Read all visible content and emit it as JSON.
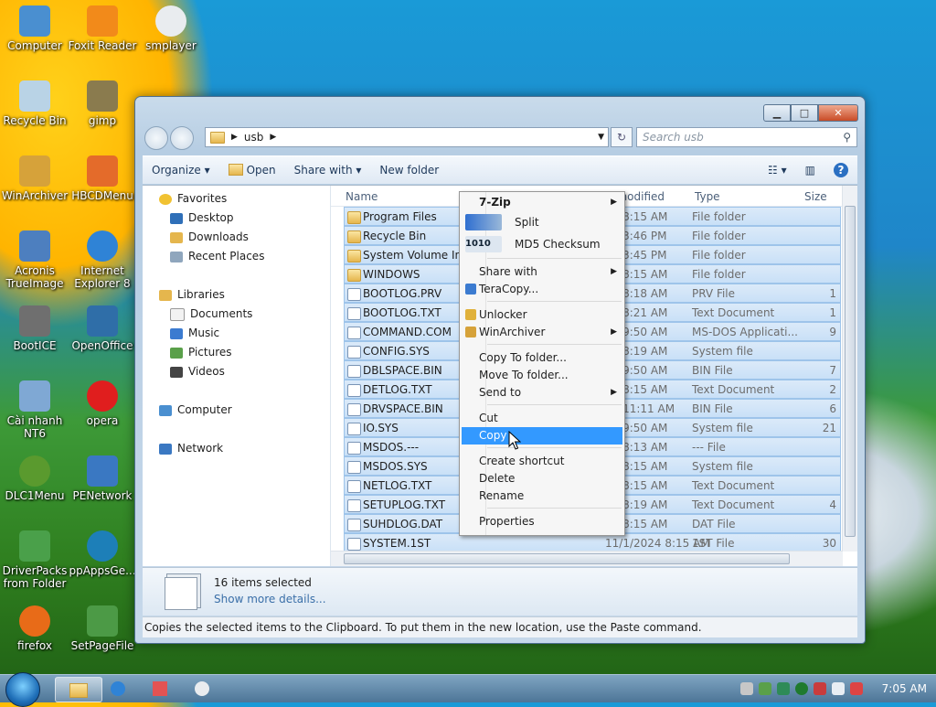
{
  "desktop": {
    "icons": [
      {
        "label": "Computer",
        "icon": "computer-icon",
        "color": "#4a8fd0"
      },
      {
        "label": "Foxit Reader",
        "icon": "pdf-icon",
        "color": "#f28a1a"
      },
      {
        "label": "smplayer",
        "icon": "penguin-icon",
        "color": "#e9ecef"
      },
      {
        "label": "Recycle Bin",
        "icon": "recycle-bin-icon",
        "color": "#b9d3e6"
      },
      {
        "label": "gimp",
        "icon": "gimp-icon",
        "color": "#8a7b4e"
      },
      {
        "label": "WinArchiver",
        "icon": "archive-icon",
        "color": "#d6a23a"
      },
      {
        "label": "HBCDMenu",
        "icon": "tools-icon",
        "color": "#e46b2a"
      },
      {
        "label": "Acronis TrueImage",
        "icon": "disk-icon",
        "color": "#4d7fbf"
      },
      {
        "label": "Internet Explorer 8",
        "icon": "ie-icon",
        "color": "#2f83d6"
      },
      {
        "label": "BootICE",
        "icon": "boot-icon",
        "color": "#6f6f6f"
      },
      {
        "label": "OpenOffice",
        "icon": "openoffice-icon",
        "color": "#2f6ea8"
      },
      {
        "label": "Cài nhanh NT6",
        "icon": "install-icon",
        "color": "#7fa8d4"
      },
      {
        "label": "opera",
        "icon": "opera-icon",
        "color": "#e01e1e"
      },
      {
        "label": "DLC1Menu",
        "icon": "dlc-icon",
        "color": "#5a9a2e"
      },
      {
        "label": "PENetwork",
        "icon": "network-icon",
        "color": "#3a78c2"
      },
      {
        "label": "DriverPacks from Folder",
        "icon": "driver-icon",
        "color": "#4aa04a"
      },
      {
        "label": "ppAppsGe...",
        "icon": "apps-icon",
        "color": "#1d7fb8"
      },
      {
        "label": "firefox",
        "icon": "firefox-icon",
        "color": "#e86b18"
      },
      {
        "label": "SetPageFile",
        "icon": "pagefile-icon",
        "color": "#4c9a46"
      }
    ]
  },
  "window": {
    "address": {
      "root": "usb"
    },
    "search_placeholder": "Search usb",
    "toolbar": {
      "organize": "Organize",
      "open": "Open",
      "share_with": "Share with",
      "new_folder": "New folder"
    },
    "nav": {
      "favorites": "Favorites",
      "desktop": "Desktop",
      "downloads": "Downloads",
      "recent": "Recent Places",
      "libraries": "Libraries",
      "documents": "Documents",
      "music": "Music",
      "pictures": "Pictures",
      "videos": "Videos",
      "computer": "Computer",
      "network": "Network"
    },
    "columns": {
      "name": "Name",
      "date": "Date modified",
      "type": "Type",
      "size": "Size"
    },
    "files": [
      {
        "name": "Program Files",
        "date": "24 8:15 AM",
        "type": "File folder",
        "size": "",
        "folder": true
      },
      {
        "name": "Recycle Bin",
        "date": "24 3:46 PM",
        "type": "File folder",
        "size": "",
        "folder": true
      },
      {
        "name": "System Volume Inf",
        "date": "24 3:45 PM",
        "type": "File folder",
        "size": "",
        "folder": true
      },
      {
        "name": "WINDOWS",
        "date": "24 8:15 AM",
        "type": "File folder",
        "size": "",
        "folder": true
      },
      {
        "name": "BOOTLOG.PRV",
        "date": "24 8:18 AM",
        "type": "PRV File",
        "size": "1",
        "folder": false
      },
      {
        "name": "BOOTLOG.TXT",
        "date": "24 8:21 AM",
        "type": "Text Document",
        "size": "1",
        "folder": false
      },
      {
        "name": "COMMAND.COM",
        "date": "05 9:50 AM",
        "type": "MS-DOS Applicati...",
        "size": "9",
        "folder": false
      },
      {
        "name": "CONFIG.SYS",
        "date": "24 8:19 AM",
        "type": "System file",
        "size": "",
        "folder": false
      },
      {
        "name": "DBLSPACE.BIN",
        "date": "05 9:50 AM",
        "type": "BIN File",
        "size": "7",
        "folder": false
      },
      {
        "name": "DETLOG.TXT",
        "date": "24 8:15 AM",
        "type": "Text Document",
        "size": "2",
        "folder": false
      },
      {
        "name": "DRVSPACE.BIN",
        "date": "06 11:11 AM",
        "type": "BIN File",
        "size": "6",
        "folder": false
      },
      {
        "name": "IO.SYS",
        "date": "05 9:50 AM",
        "type": "System file",
        "size": "21",
        "folder": false
      },
      {
        "name": "MSDOS.---",
        "date": "24 8:13 AM",
        "type": "--- File",
        "size": "",
        "folder": false
      },
      {
        "name": "MSDOS.SYS",
        "date": "24 8:15 AM",
        "type": "System file",
        "size": "",
        "folder": false
      },
      {
        "name": "NETLOG.TXT",
        "date": "24 8:15 AM",
        "type": "Text Document",
        "size": "",
        "folder": false
      },
      {
        "name": "SETUPLOG.TXT",
        "date": "24 8:19 AM",
        "type": "Text Document",
        "size": "4",
        "folder": false
      },
      {
        "name": "SUHDLOG.DAT",
        "date": "24 8:15 AM",
        "type": "DAT File",
        "size": "",
        "folder": false
      },
      {
        "name": "SYSTEM.1ST",
        "date": "11/1/2024 8:15 AM",
        "type": "1ST File",
        "size": "30",
        "folder": false
      }
    ],
    "details": {
      "count": "16 items selected",
      "more": "Show more details..."
    },
    "status": "Copies the selected items to the Clipboard. To put them in the new location, use the Paste command."
  },
  "context_menu": {
    "zip": "7-Zip",
    "split": "Split",
    "md5": "MD5 Checksum",
    "share_with": "Share with",
    "teracopy": "TeraCopy...",
    "unlocker": "Unlocker",
    "winarchiver": "WinArchiver",
    "copy_to": "Copy To folder...",
    "move_to": "Move To folder...",
    "send_to": "Send to",
    "cut": "Cut",
    "copy": "Copy",
    "create_shortcut": "Create shortcut",
    "delete": "Delete",
    "rename": "Rename",
    "properties": "Properties"
  },
  "taskbar": {
    "clock": "7:05 AM"
  }
}
